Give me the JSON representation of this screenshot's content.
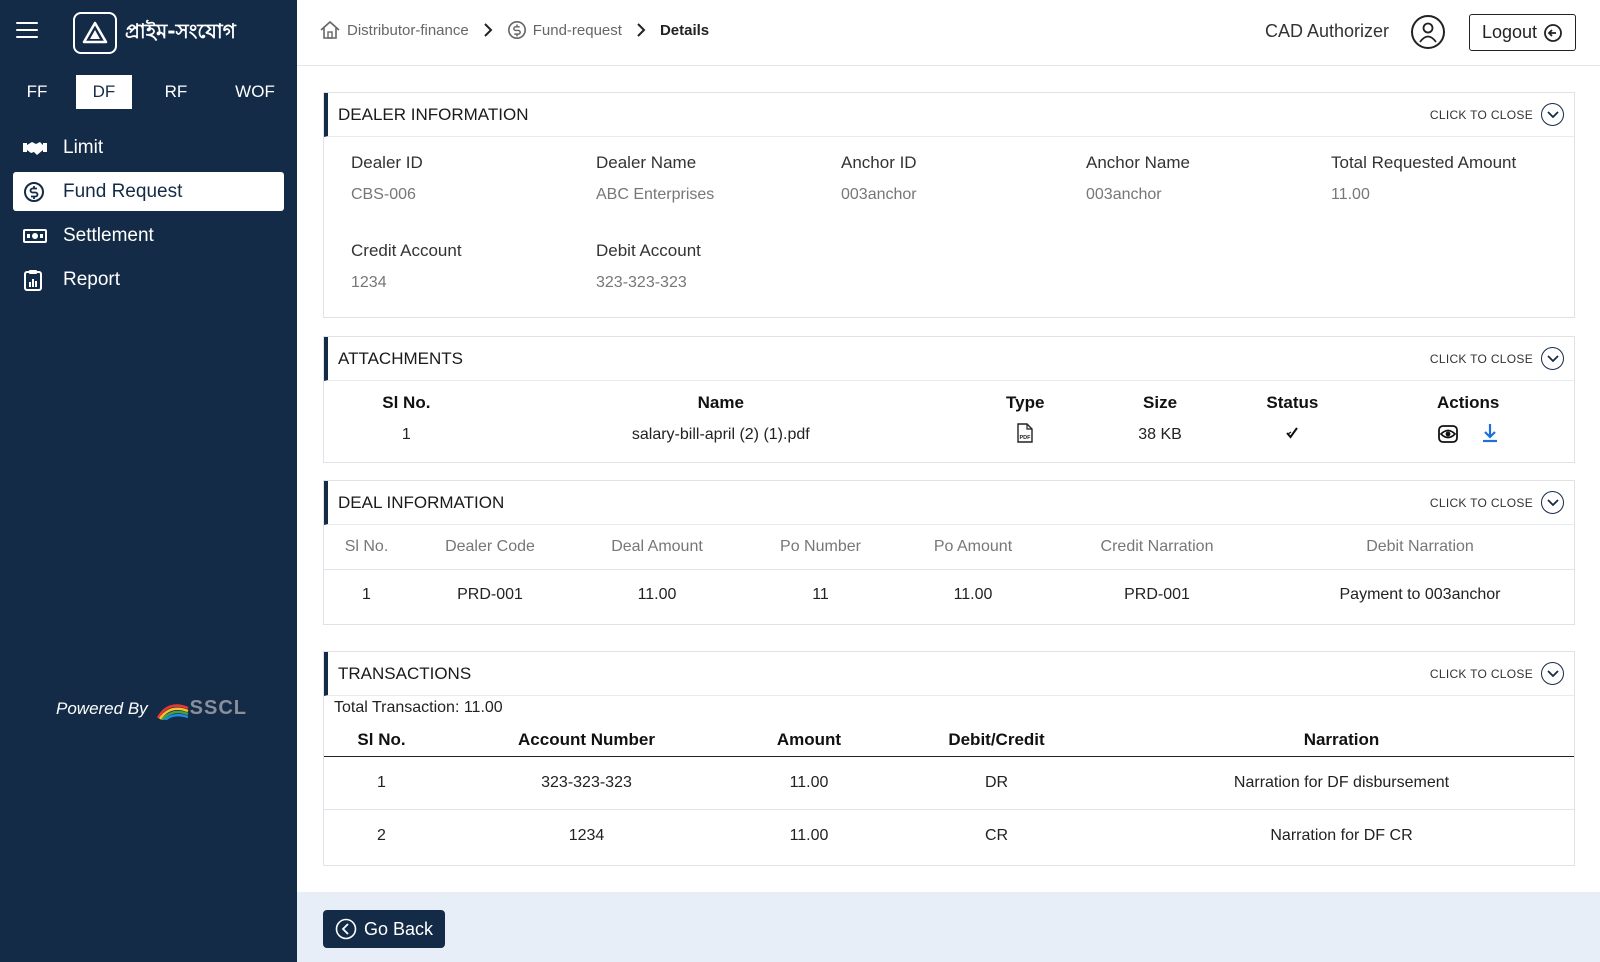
{
  "brand": {
    "name": "প্রাইম-সংযোগ"
  },
  "module_tabs": [
    "FF",
    "DF",
    "RF",
    "WOF"
  ],
  "nav": {
    "limit": "Limit",
    "fund_request": "Fund Request",
    "settlement": "Settlement",
    "report": "Report"
  },
  "powered": {
    "label": "Powered By",
    "logo_text": "SSCL"
  },
  "breadcrumb": {
    "item1": "Distributor-finance",
    "item2": "Fund-request",
    "item3": "Details"
  },
  "header": {
    "role": "CAD Authorizer",
    "logout": "Logout"
  },
  "collapse_label": "CLICK TO CLOSE",
  "dealer": {
    "title": "DEALER INFORMATION",
    "dealer_id_label": "Dealer ID",
    "dealer_id": "CBS-006",
    "dealer_name_label": "Dealer Name",
    "dealer_name": "ABC Enterprises",
    "anchor_id_label": "Anchor ID",
    "anchor_id": "003anchor",
    "anchor_name_label": "Anchor Name",
    "anchor_name": "003anchor",
    "total_label": "Total Requested Amount",
    "total": "11.00",
    "credit_label": "Credit Account",
    "credit": "1234",
    "debit_label": "Debit Account",
    "debit": "323-323-323"
  },
  "attachments": {
    "title": "ATTACHMENTS",
    "headers": {
      "sl": "Sl No.",
      "name": "Name",
      "type": "Type",
      "size": "Size",
      "status": "Status",
      "actions": "Actions"
    },
    "rows": [
      {
        "sl": "1",
        "name": "salary-bill-april (2) (1).pdf",
        "type_icon": "pdf-file-icon",
        "type_text": "PDF",
        "size": "38 KB",
        "status_icon": "check-icon"
      }
    ]
  },
  "deal": {
    "title": "DEAL INFORMATION",
    "headers": {
      "sl": "Sl No.",
      "code": "Dealer Code",
      "amount": "Deal Amount",
      "po_number": "Po Number",
      "po_amount": "Po Amount",
      "credit_narration": "Credit Narration",
      "debit_narration": "Debit Narration"
    },
    "rows": [
      {
        "sl": "1",
        "code": "PRD-001",
        "amount": "11.00",
        "po_number": "11",
        "po_amount": "11.00",
        "credit_narration": "PRD-001",
        "debit_narration": "Payment to 003anchor"
      }
    ]
  },
  "transactions": {
    "title": "TRANSACTIONS",
    "total": "Total Transaction: 11.00",
    "headers": {
      "sl": "Sl No.",
      "account": "Account Number",
      "amount": "Amount",
      "dc": "Debit/Credit",
      "narration": "Narration"
    },
    "rows": [
      {
        "sl": "1",
        "account": "323-323-323",
        "amount": "11.00",
        "dc": "DR",
        "narration": "Narration for DF disbursement"
      },
      {
        "sl": "2",
        "account": "1234",
        "amount": "11.00",
        "dc": "CR",
        "narration": "Narration for DF CR"
      }
    ]
  },
  "footer": {
    "go_back": "Go Back"
  },
  "colors": {
    "sidebar": "#142b47",
    "footer_bg": "#e8eef8",
    "link_blue": "#1e6fd9"
  }
}
